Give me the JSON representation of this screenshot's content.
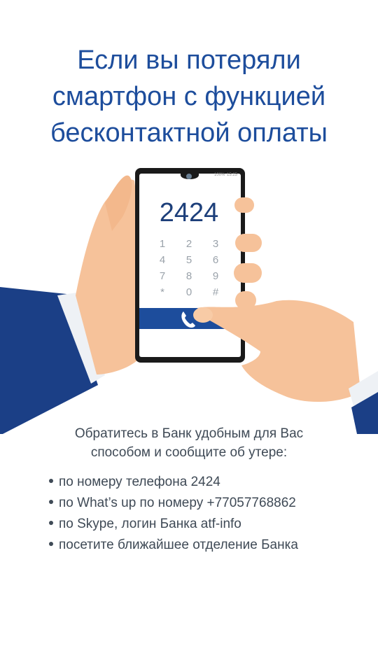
{
  "headline": {
    "line1": "Если вы потеряли",
    "line2": "смартфон с функцией",
    "line3": "бесконтактной оплаты"
  },
  "phone": {
    "status_battery": "100%",
    "status_time": "15:25",
    "dialed_number": "2424",
    "keypad": [
      "1",
      "2",
      "3",
      "4",
      "5",
      "6",
      "7",
      "8",
      "9",
      "*",
      "0",
      "#"
    ],
    "icons": [
      "call-icon",
      "camera-icon"
    ]
  },
  "info": {
    "intro_line1": "Обратитесь в Банк удобным для Вас",
    "intro_line2": "способом и сообщите об утере:",
    "items": [
      "по номеру телефона 2424",
      "по What’s up по номеру +77057768862",
      "по Skype, логин Банка atf-info",
      "посетите ближайшее отделение Банка"
    ]
  },
  "colors": {
    "accent_blue": "#1d4d9c",
    "sleeve_navy": "#1b3f86",
    "skin": "#f6c29a",
    "text_gray": "#3f4a56"
  }
}
